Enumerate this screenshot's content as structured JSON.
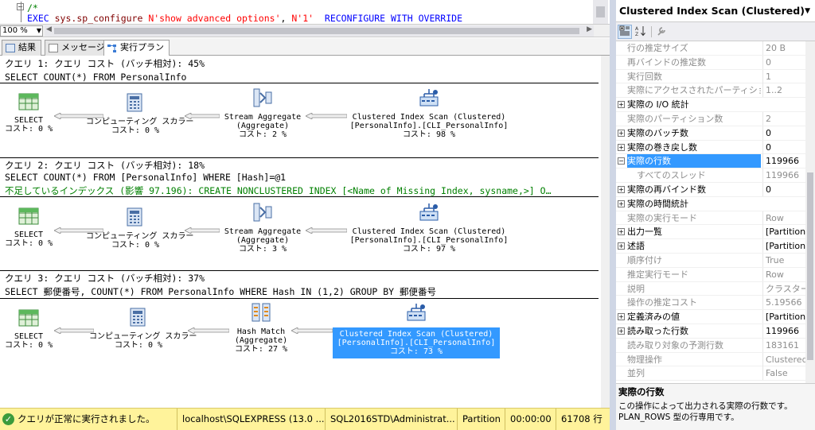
{
  "editor": {
    "line1": "/*",
    "line2_kw": "EXEC",
    "line2_proc": " sys.sp_configure ",
    "line2_str1": "N'show advanced options'",
    "line2_mid": ", ",
    "line2_str2": "N'1'",
    "line2_tail": "  RECONFIGURE WITH OVERRIDE"
  },
  "zoom": {
    "value": "100 %"
  },
  "tabs": [
    {
      "label": "結果"
    },
    {
      "label": "メッセージ"
    },
    {
      "label": "実行プラン"
    }
  ],
  "queries": [
    {
      "header": "クエリ 1: クエリ コスト (バッチ相対): 45%",
      "sql": "SELECT COUNT(*) FROM PersonalInfo",
      "missing": "",
      "nodes": [
        {
          "title": "SELECT",
          "sub": "",
          "cost": "コスト: 0 %"
        },
        {
          "title": "コンピューティング スカラー",
          "sub": "",
          "cost": "コスト: 0 %"
        },
        {
          "title": "Stream Aggregate",
          "sub": "(Aggregate)",
          "cost": "コスト: 2 %"
        },
        {
          "title": "Clustered Index Scan (Clustered)",
          "sub": "[PersonalInfo].[CLI_PersonalInfo]",
          "cost": "コスト: 98 %"
        }
      ]
    },
    {
      "header": "クエリ 2: クエリ コスト (バッチ相対): 18%",
      "sql": "SELECT COUNT(*) FROM [PersonalInfo] WHERE [Hash]=@1",
      "missing": "不足しているインデックス (影響 97.196): CREATE NONCLUSTERED INDEX [<Name of Missing Index, sysname,>] O…",
      "nodes": [
        {
          "title": "SELECT",
          "sub": "",
          "cost": "コスト: 0 %"
        },
        {
          "title": "コンピューティング スカラー",
          "sub": "",
          "cost": "コスト: 0 %"
        },
        {
          "title": "Stream Aggregate",
          "sub": "(Aggregate)",
          "cost": "コスト: 3 %"
        },
        {
          "title": "Clustered Index Scan (Clustered)",
          "sub": "[PersonalInfo].[CLI_PersonalInfo]",
          "cost": "コスト: 97 %"
        }
      ]
    },
    {
      "header": "クエリ 3: クエリ コスト (バッチ相対): 37%",
      "sql": "SELECT 郵便番号, COUNT(*) FROM PersonalInfo WHERE Hash IN (1,2) GROUP BY 郵便番号",
      "missing": "",
      "nodes": [
        {
          "title": "SELECT",
          "sub": "",
          "cost": "コスト: 0 %"
        },
        {
          "title": "コンピューティング スカラー",
          "sub": "",
          "cost": "コスト: 0 %"
        },
        {
          "title": "Hash Match",
          "sub": "(Aggregate)",
          "cost": "コスト: 27 %"
        },
        {
          "title": "Clustered Index Scan (Clustered)",
          "sub": "[PersonalInfo].[CLI_PersonalInfo]",
          "cost": "コスト: 73 %"
        }
      ]
    }
  ],
  "status": {
    "message": "クエリが正常に実行されました。",
    "server": "localhost\\SQLEXPRESS (13.0 ...",
    "login": "SQL2016STD\\Administrat...",
    "database": "Partition",
    "elapsed": "00:00:00",
    "rows": "61708 行"
  },
  "properties": {
    "title": "Clustered Index Scan (Clustered)",
    "rows": [
      {
        "name": "行の推定サイズ",
        "value": "20 B",
        "expand": "",
        "gray": true
      },
      {
        "name": "再バインドの推定数",
        "value": "0",
        "expand": "",
        "gray": true
      },
      {
        "name": "実行回数",
        "value": "1",
        "expand": "",
        "gray": true
      },
      {
        "name": "実際にアクセスされたパーティション",
        "value": "1..2",
        "expand": "",
        "gray": true
      },
      {
        "name": "実際の I/O 統計",
        "value": "",
        "expand": "+",
        "gray": false
      },
      {
        "name": "実際のパーティション数",
        "value": "2",
        "expand": "",
        "gray": true
      },
      {
        "name": "実際のバッチ数",
        "value": "0",
        "expand": "+",
        "gray": false
      },
      {
        "name": "実際の巻き戻し数",
        "value": "0",
        "expand": "+",
        "gray": false
      },
      {
        "name": "実際の行数",
        "value": "119966",
        "expand": "−",
        "gray": false,
        "selected": true
      },
      {
        "name": "すべてのスレッド",
        "value": "119966",
        "expand": "",
        "gray": true,
        "sub": true
      },
      {
        "name": "実際の再バインド数",
        "value": "0",
        "expand": "+",
        "gray": false
      },
      {
        "name": "実際の時間統計",
        "value": "",
        "expand": "+",
        "gray": false
      },
      {
        "name": "実際の実行モード",
        "value": "Row",
        "expand": "",
        "gray": true
      },
      {
        "name": "出力一覧",
        "value": "[Partition",
        "expand": "+",
        "gray": false
      },
      {
        "name": "述語",
        "value": "[Partition",
        "expand": "+",
        "gray": false
      },
      {
        "name": "順序付け",
        "value": "True",
        "expand": "",
        "gray": true
      },
      {
        "name": "推定実行モード",
        "value": "Row",
        "expand": "",
        "gray": true
      },
      {
        "name": "説明",
        "value": "クラスター化",
        "expand": "",
        "gray": true
      },
      {
        "name": "操作の推定コスト",
        "value": "5.19566",
        "expand": "",
        "gray": true
      },
      {
        "name": "定義済みの値",
        "value": "[Partition",
        "expand": "+",
        "gray": false
      },
      {
        "name": "読み取った行数",
        "value": "119966",
        "expand": "+",
        "gray": false
      },
      {
        "name": "読み取り対象の予測行数",
        "value": "183161",
        "expand": "",
        "gray": true
      },
      {
        "name": "物理操作",
        "value": "Clustered",
        "expand": "",
        "gray": true
      },
      {
        "name": "並列",
        "value": "False",
        "expand": "",
        "gray": true
      }
    ],
    "desc_title": "実際の行数",
    "desc_text_1": "この操作によって出力される実際の行数です。",
    "desc_text_2": "PLAN_ROWS 型の行専用です。"
  },
  "icons": {
    "select": "select-icon",
    "compute": "compute-scalar-icon",
    "aggregate": "aggregate-icon",
    "scan": "clustered-index-scan-icon"
  },
  "colors": {
    "selection": "#3399ff",
    "status_bar": "#fff39b",
    "missing_index": "#008000"
  }
}
